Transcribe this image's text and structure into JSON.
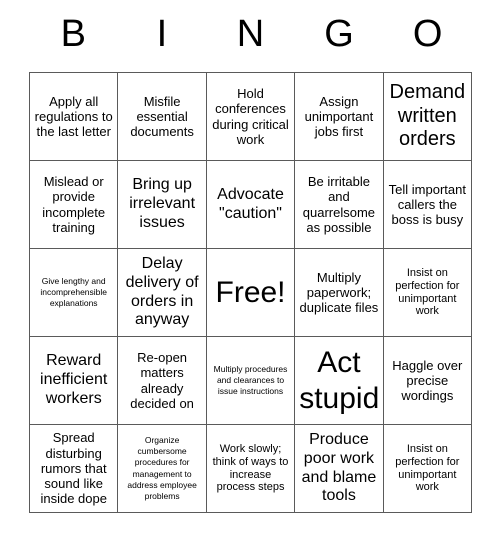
{
  "header": {
    "letters": [
      "B",
      "I",
      "N",
      "G",
      "O"
    ]
  },
  "grid": {
    "rows": 5,
    "columns": 5,
    "cells": [
      [
        {
          "text": "Apply all regulations to the last letter",
          "size": "m"
        },
        {
          "text": "Misfile essential documents",
          "size": "m"
        },
        {
          "text": "Hold conferences during critical work",
          "size": "m"
        },
        {
          "text": "Assign unimportant jobs first",
          "size": "m"
        },
        {
          "text": "Demand written orders",
          "size": "xl"
        }
      ],
      [
        {
          "text": "Mislead or provide incomplete training",
          "size": "m"
        },
        {
          "text": "Bring up irrelevant issues",
          "size": "l"
        },
        {
          "text": "Advocate \"caution\"",
          "size": "l"
        },
        {
          "text": "Be irritable and quarrelsome as possible",
          "size": "m"
        },
        {
          "text": "Tell important callers the boss is busy",
          "size": "m"
        }
      ],
      [
        {
          "text": "Give lengthy and incomprehensible explanations",
          "size": "xs"
        },
        {
          "text": "Delay delivery of orders in anyway",
          "size": "l"
        },
        {
          "text": "Free!",
          "size": "xxl"
        },
        {
          "text": "Multiply paperwork; duplicate files",
          "size": "m"
        },
        {
          "text": "Insist on perfection for unimportant work",
          "size": "s"
        }
      ],
      [
        {
          "text": "Reward inefficient workers",
          "size": "l"
        },
        {
          "text": "Re-open matters already decided on",
          "size": "m"
        },
        {
          "text": "Multiply procedures and clearances to issue instructions",
          "size": "xs"
        },
        {
          "text": "Act stupid",
          "size": "xxl"
        },
        {
          "text": "Haggle over precise wordings",
          "size": "m"
        }
      ],
      [
        {
          "text": "Spread disturbing rumors that sound like inside dope",
          "size": "m"
        },
        {
          "text": "Organize cumbersome procedures for management to address employee problems",
          "size": "xs"
        },
        {
          "text": "Work slowly; think of ways to increase process steps",
          "size": "s"
        },
        {
          "text": "Produce poor work and blame tools",
          "size": "l"
        },
        {
          "text": "Insist on perfection for unimportant work",
          "size": "s"
        }
      ]
    ]
  },
  "colors": {
    "background": "#ffffff",
    "border": "#5a5a5a",
    "text": "#000000"
  }
}
